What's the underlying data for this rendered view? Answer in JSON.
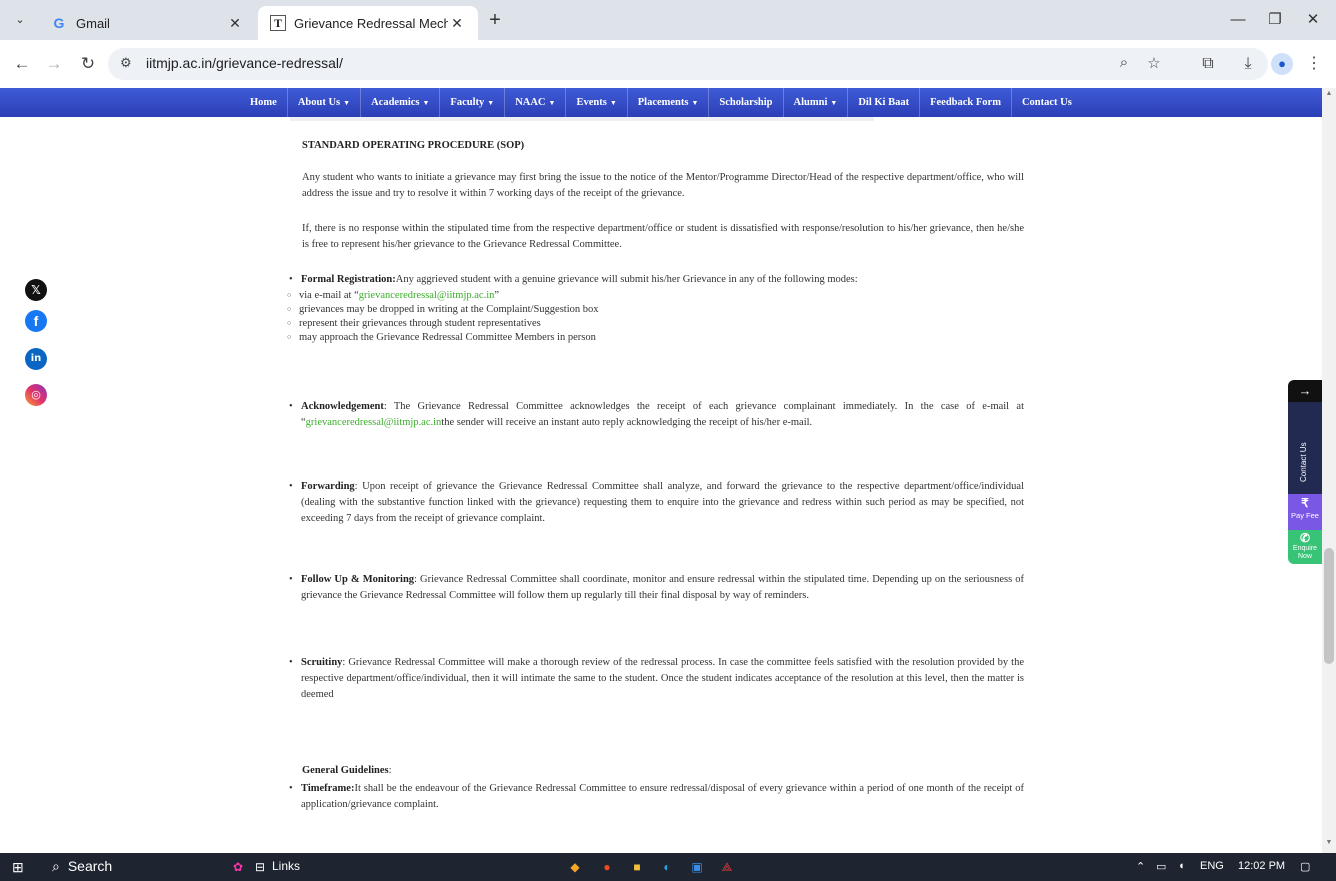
{
  "browser": {
    "tabs": [
      {
        "title": "Gmail",
        "favicon": "G"
      },
      {
        "title": "Grievance Redressal Mechanism",
        "favicon": "IT"
      }
    ],
    "url": "iitmjp.ac.in/grievance-redressal/"
  },
  "nav": {
    "items": [
      {
        "label": "Home",
        "caret": ""
      },
      {
        "label": "About Us",
        "caret": "▼"
      },
      {
        "label": "Academics",
        "caret": "▼"
      },
      {
        "label": "Faculty",
        "caret": "▼"
      },
      {
        "label": "NAAC",
        "caret": "▼"
      },
      {
        "label": "Events",
        "caret": "▼"
      },
      {
        "label": "Placements",
        "caret": "▼"
      },
      {
        "label": "Scholarship",
        "caret": ""
      },
      {
        "label": "Alumni",
        "caret": "▼"
      },
      {
        "label": "Dil Ki Baat",
        "caret": ""
      },
      {
        "label": "Feedback Form",
        "caret": ""
      },
      {
        "label": "Contact Us",
        "caret": ""
      }
    ]
  },
  "content": {
    "sop_heading": "STANDARD OPERATING PROCEDURE (SOP)",
    "para1": "Any student who wants to initiate a grievance may first bring the issue to the notice of the Mentor/Programme Director/Head of the respective department/office, who will address the issue and try to resolve it within 7 working days of the receipt of the grievance.",
    "para2": "If, there is no response within the stipulated time from the respective department/office or student is dissatisfied with response/resolution to his/her grievance, then he/she is free to represent his/her grievance to the Grievance Redressal Committee.",
    "formal_label": "Formal Registration:",
    "formal_text": "Any aggrieved student with a genuine grievance will submit his/her Grievance in any of the following modes:",
    "modes": {
      "email_prefix": "via e-mail at “",
      "email": "grievanceredressal@iitmjp.ac.in",
      "email_suffix": "”",
      "m2": "grievances may be dropped in writing at the Complaint/Suggestion box",
      "m3": "represent their grievances through student representatives",
      "m4": "may approach the Grievance Redressal Committee Members in person"
    },
    "ack_label": "Acknowledgement",
    "ack_text1": ": The Grievance Redressal Committee acknowledges the receipt of each grievance complainant immediately. In the case of e-mail at “",
    "ack_email": "grievanceredressal@iitmjp.ac.in",
    "ack_text2": "the sender will receive an instant auto reply acknowledging the receipt of his/her e-mail.",
    "fwd_label": "Forwarding",
    "fwd_text": ": Upon receipt of grievance the Grievance Redressal Committee shall analyze, and forward the grievance to the respective department/office/individual (dealing with the substantive function linked with the grievance) requesting them to enquire into the grievance and redress within such period as may be specified, not exceeding 7 days from the receipt of grievance complaint.",
    "follow_label": "Follow Up & Monitoring",
    "follow_text": ": Grievance Redressal Committee shall coordinate, monitor and ensure redressal within the stipulated time. Depending up on the seriousness of grievance the Grievance Redressal Committee will follow them up regularly till their final disposal by way of reminders.",
    "scrutiny_label": "Scruitiny",
    "scrutiny_text": ": Grievance Redressal Committee will make a thorough review of the redressal process. In case the committee feels satisfied with the resolution provided by the respective department/office/individual, then it will intimate the same to the student. Once the student indicates acceptance of the resolution at this level, then the matter is deemed",
    "guidelines_label": "General Guidelines",
    "guidelines_colon": ":",
    "timeframe_label": "Timeframe:",
    "timeframe_text": "It shall be the endeavour of the Grievance Redressal Committee to ensure redressal/disposal of every grievance within a period of one month of the receipt of application/grievance complaint."
  },
  "widget": {
    "contact": "Contact Us",
    "pay": "Pay Fee",
    "enquire_1": "Enquire",
    "enquire_2": "Now"
  },
  "taskbar": {
    "search": "Search",
    "links": "Links",
    "lang": "ENG",
    "time": "12:02 PM"
  },
  "colors": {
    "nav_bg": "#2f47c4",
    "email_green": "#3bae2a",
    "pay_fee": "#7b57e5",
    "enquire": "#38c477"
  }
}
